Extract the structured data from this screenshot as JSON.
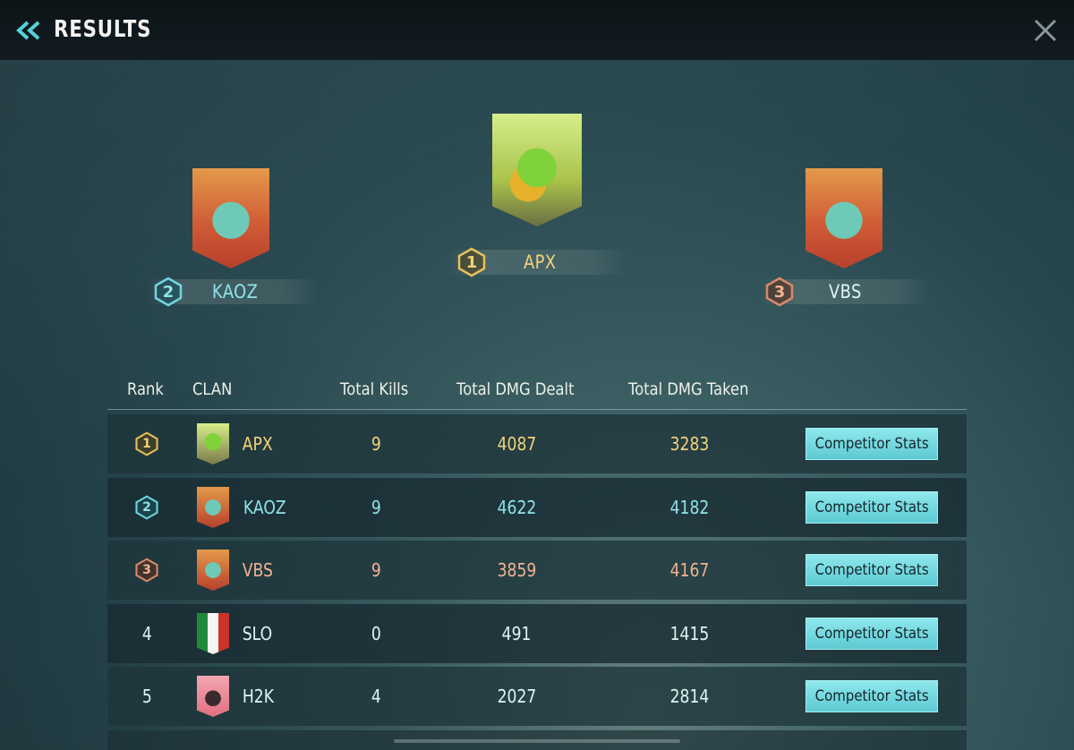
{
  "header": {
    "title": "RESULTS",
    "back_icon": "double-chevron-left-icon",
    "close_icon": "close-icon"
  },
  "colors": {
    "gold": "#f3d27a",
    "silver": "#8fe3ea",
    "bronze": "#f0b392",
    "white": "#dff4f4",
    "accent_button": "#6ed6de"
  },
  "podium": [
    {
      "rank": "1",
      "name": "APX",
      "logo": "slime-emblem"
    },
    {
      "rank": "2",
      "name": "KAOZ",
      "logo": "duck-emblem"
    },
    {
      "rank": "3",
      "name": "VBS",
      "logo": "duck-emblem"
    }
  ],
  "table": {
    "headers": {
      "rank": "Rank",
      "clan": "CLAN",
      "kills": "Total Kills",
      "dealt": "Total DMG Dealt",
      "taken": "Total DMG Taken"
    },
    "rows": [
      {
        "rank": "1",
        "clan": "APX",
        "kills": "9",
        "dealt": "4087",
        "taken": "3283",
        "button": "Competitor Stats"
      },
      {
        "rank": "2",
        "clan": "KAOZ",
        "kills": "9",
        "dealt": "4622",
        "taken": "4182",
        "button": "Competitor Stats"
      },
      {
        "rank": "3",
        "clan": "VBS",
        "kills": "9",
        "dealt": "3859",
        "taken": "4167",
        "button": "Competitor Stats"
      },
      {
        "rank": "4",
        "clan": "SLO",
        "kills": "0",
        "dealt": "491",
        "taken": "1415",
        "button": "Competitor Stats"
      },
      {
        "rank": "5",
        "clan": "H2K",
        "kills": "4",
        "dealt": "2027",
        "taken": "2814",
        "button": "Competitor Stats"
      }
    ]
  }
}
